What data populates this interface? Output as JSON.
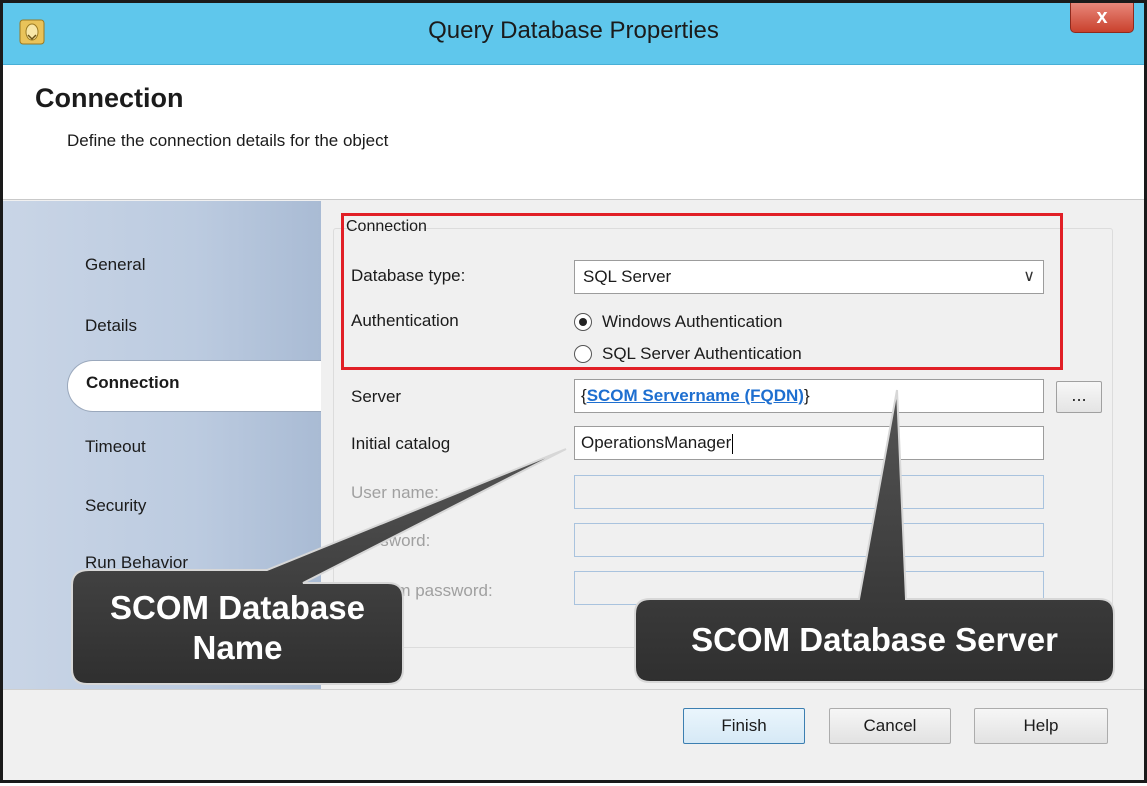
{
  "window": {
    "title": "Query Database Properties",
    "close_label": "x"
  },
  "header": {
    "title": "Connection",
    "subtitle": "Define the connection details for the object"
  },
  "sidebar": {
    "items": [
      {
        "label": "General"
      },
      {
        "label": "Details"
      },
      {
        "label": "Connection"
      },
      {
        "label": "Timeout"
      },
      {
        "label": "Security"
      },
      {
        "label": "Run Behavior"
      }
    ],
    "active_index": 2
  },
  "connection": {
    "group_label": "Connection",
    "database_type_label": "Database type:",
    "database_type_value": "SQL Server",
    "authentication_label": "Authentication",
    "auth_windows": "Windows Authentication",
    "auth_sql": "SQL Server Authentication",
    "auth_selected": "Windows Authentication"
  },
  "fields": {
    "server_label": "Server",
    "server_prefix": "{",
    "server_value": "SCOM Servername (FQDN)",
    "server_suffix": "}",
    "browse_label": "...",
    "catalog_label": "Initial catalog",
    "catalog_value": "OperationsManager",
    "username_label": "User name:",
    "password_label": "Password:",
    "confirm_label": "Confirm password:"
  },
  "callouts": {
    "database_name": "SCOM Database Name",
    "database_server": "SCOM Database Server"
  },
  "buttons": {
    "finish": "Finish",
    "cancel": "Cancel",
    "help": "Help"
  },
  "colors": {
    "titlebar": "#5fc7ec",
    "highlight_box": "#e11f26",
    "link": "#1e6fd0",
    "callout": "#3d3d3d"
  }
}
